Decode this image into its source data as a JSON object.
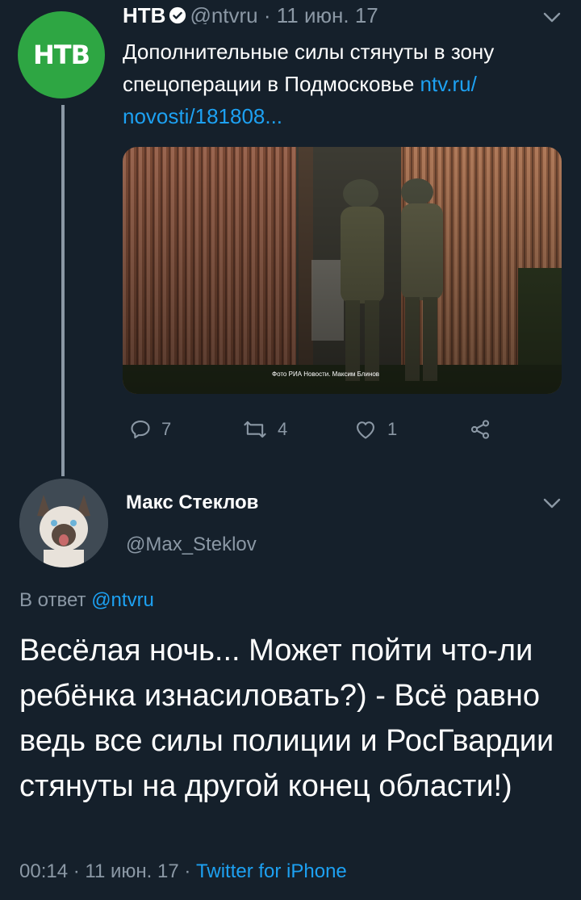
{
  "tweet1": {
    "display_name": "НТВ",
    "handle": "@ntvru",
    "separator": "·",
    "date": "11 июн. 17",
    "text": "Дополнительные силы стянуты в зону спецоперации в Подмосковье ",
    "link_part1": "ntv.ru/",
    "link_part2": "novosti/181808...",
    "image_caption": "Фото РИА Новости. Максим Блинов",
    "replies": "7",
    "retweets": "4",
    "likes": "1",
    "avatar_logo": "НТВ"
  },
  "tweet2": {
    "display_name": "Макс Стеклов",
    "handle": "@Max_Steklov",
    "reply_prefix": "В ответ ",
    "reply_handle": "@ntvru",
    "text": "Весёлая ночь... Может пойти что-ли ребёнка изнасиловать?) - Всё равно ведь все силы полиции и РосГвардии стянуты на другой конец области!)",
    "time": "00:14",
    "date": "11 июн. 17",
    "separator": "·",
    "source": "Twitter for iPhone"
  },
  "colors": {
    "background": "#15202b",
    "accent": "#1da1f2",
    "secondary_text": "#8b98a5",
    "ntv_green": "#2ea643"
  },
  "icons": [
    "verified-badge-icon",
    "chevron-down-icon",
    "reply-icon",
    "retweet-icon",
    "like-icon",
    "share-icon"
  ]
}
